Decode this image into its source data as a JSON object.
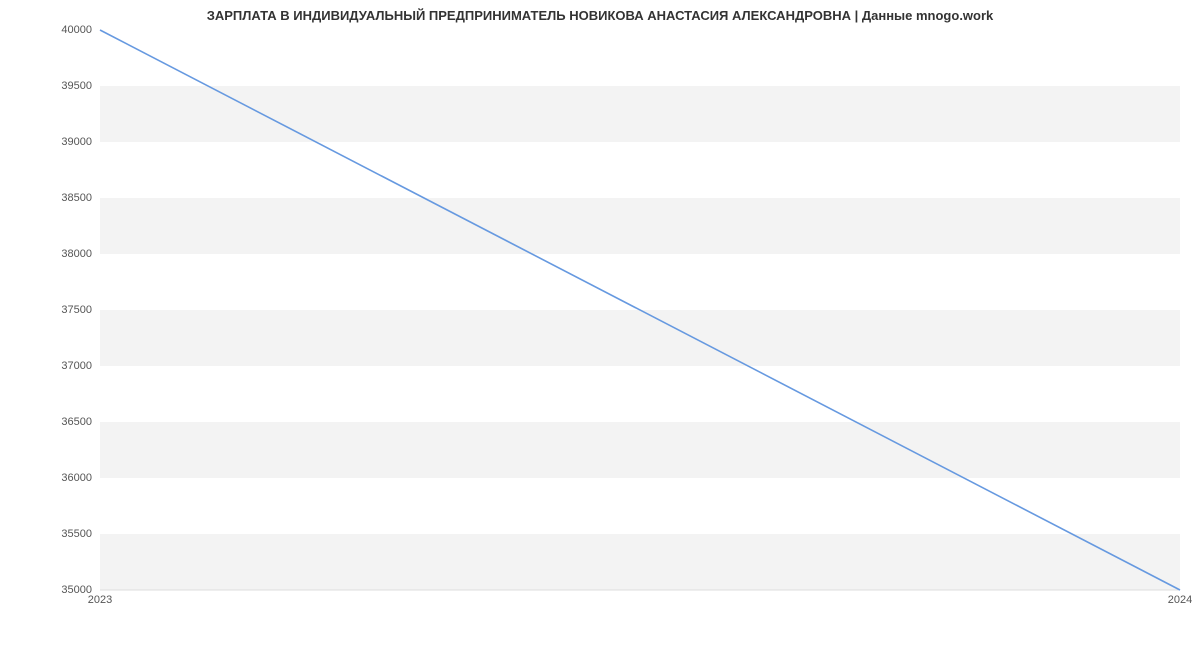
{
  "chart_data": {
    "type": "line",
    "title": "ЗАРПЛАТА В ИНДИВИДУАЛЬНЫЙ ПРЕДПРИНИМАТЕЛЬ НОВИКОВА АНАСТАСИЯ АЛЕКСАНДРОВНА | Данные mnogo.work",
    "x": [
      2023,
      2024
    ],
    "values": [
      40000,
      35000
    ],
    "xlabel": "",
    "ylabel": "",
    "xlim": [
      2023,
      2024
    ],
    "ylim": [
      35000,
      40000
    ],
    "y_ticks": [
      35000,
      35500,
      36000,
      36500,
      37000,
      37500,
      38000,
      38500,
      39000,
      39500,
      40000
    ],
    "x_ticks": [
      2023,
      2024
    ],
    "grid": true,
    "line_color": "#6699e0",
    "band_color": "#f3f3f3"
  }
}
